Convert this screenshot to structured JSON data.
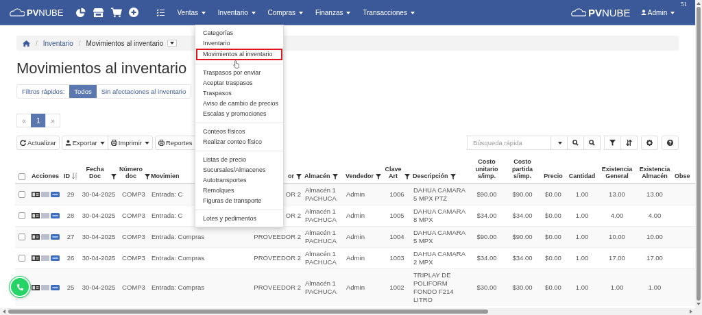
{
  "header": {
    "logo": "**PV**NUBE",
    "nav": [
      "Ventas",
      "Inventario",
      "Compras",
      "Finanzas",
      "Transacciones"
    ],
    "brand": "**PV**NUBE",
    "user": "Admin",
    "counter": "51"
  },
  "inventory_menu": {
    "groups": [
      [
        {
          "label": "Categorías",
          "selected": false
        },
        {
          "label": "Inventario",
          "selected": false
        },
        {
          "label": "Movimientos al inventario",
          "selected": true
        }
      ],
      [
        {
          "label": "Traspasos por enviar",
          "selected": false
        },
        {
          "label": "Aceptar traspasos",
          "selected": false
        },
        {
          "label": "Traspasos",
          "selected": false
        },
        {
          "label": "Aviso de cambio de precios",
          "selected": false
        },
        {
          "label": "Escalas y promociones",
          "selected": false
        }
      ],
      [
        {
          "label": "Conteos físicos",
          "selected": false
        },
        {
          "label": "Realizar conteo físico",
          "selected": false
        }
      ],
      [
        {
          "label": "Listas de precio",
          "selected": false
        },
        {
          "label": "Sucursales/Almacenes",
          "selected": false
        },
        {
          "label": "Autotransportes",
          "selected": false
        },
        {
          "label": "Remolques",
          "selected": false
        },
        {
          "label": "Figuras de transporte",
          "selected": false
        }
      ],
      [
        {
          "label": "Lotes y pedimentos",
          "selected": false
        }
      ]
    ]
  },
  "breadcrumb": {
    "separator": "/",
    "items": [
      "Inventario",
      "Movimientos al inventario"
    ]
  },
  "title": "Movimientos al inventario",
  "quick_filters": {
    "label": "Filtros rápidos:",
    "options": [
      {
        "label": "Todos",
        "selected": true
      },
      {
        "label": "Sin afectaciones al inventario",
        "selected": false
      }
    ]
  },
  "pagination": {
    "prev": "«",
    "pages": [
      {
        "label": "1",
        "selected": true
      }
    ],
    "next": "»"
  },
  "toolbar": {
    "buttons": [
      {
        "label": "Actualizar",
        "dropdown": false
      },
      {
        "label": "Exportar",
        "dropdown": true
      },
      {
        "label": "Imprimir",
        "dropdown": true
      },
      {
        "label": "Reportes",
        "dropdown": false
      }
    ]
  },
  "search": {
    "placeholder": "Búsqueda rápida"
  },
  "table": {
    "columns": [
      {
        "kind": "checkbox",
        "checked": false
      },
      {
        "kind": "label",
        "label": "Acciones",
        "filter": false,
        "sorted": false
      },
      {
        "kind": "label",
        "label": "ID",
        "filter": false,
        "sorted": true
      },
      {
        "kind": "label",
        "label": "Fecha Doc",
        "filter": true,
        "sorted": false
      },
      {
        "kind": "label",
        "label": "Número doc",
        "filter": true,
        "sorted": false
      },
      {
        "kind": "label",
        "label": "Movimien",
        "filter": false,
        "sorted": false
      },
      {
        "kind": "label",
        "label": "or",
        "filter": true,
        "sorted": false
      },
      {
        "kind": "label",
        "label": "Almacén",
        "filter": true,
        "sorted": false
      },
      {
        "kind": "label",
        "label": "Vendedor",
        "filter": true,
        "sorted": false
      },
      {
        "kind": "label",
        "label": "Clave Art",
        "filter": true,
        "sorted": false
      },
      {
        "kind": "label",
        "label": "Descripción",
        "filter": true,
        "sorted": false
      },
      {
        "kind": "label",
        "label": "Costo unitario s/imp.",
        "filter": false,
        "sorted": false
      },
      {
        "kind": "label",
        "label": "Costo partida s/imp.",
        "filter": false,
        "sorted": false
      },
      {
        "kind": "label",
        "label": "Precio",
        "filter": false,
        "sorted": false
      },
      {
        "kind": "label",
        "label": "Cantidad",
        "filter": false,
        "sorted": false
      },
      {
        "kind": "label",
        "label": "Existencia General",
        "filter": false,
        "sorted": false
      },
      {
        "kind": "label",
        "label": "Existencia Almacén",
        "filter": false,
        "sorted": false
      },
      {
        "kind": "label",
        "label": "Obse",
        "filter": false,
        "sorted": false
      }
    ],
    "rows": [
      {
        "checked": false,
        "cells": [
          "",
          "",
          "29",
          "30-04-2025",
          "COMP3",
          "Entrada: C",
          "OR 2",
          "Almacén 1 PACHUCA",
          "Admin",
          "1006",
          "DAHUA CAMARA 5 MPX PTZ",
          "$90.00",
          "$90.00",
          "$0.00",
          "1.00",
          "13.00",
          "13.00"
        ]
      },
      {
        "checked": false,
        "cells": [
          "",
          "",
          "28",
          "30-04-2025",
          "COMP3",
          "Entrada: C",
          "OR 2",
          "Almacén 1 PACHUCA",
          "Admin",
          "1005",
          "DAHUA CAMARA 8 MPX",
          "$34.00",
          "$34.00",
          "$0.00",
          "1.00",
          "4.00",
          "4.00"
        ]
      },
      {
        "checked": false,
        "cells": [
          "",
          "",
          "27",
          "30-04-2025",
          "COMP3",
          "Entrada: Compras",
          "PROVEEDOR 2",
          "Almacén 1 PACHUCA",
          "Admin",
          "1004",
          "DAHUA CAMARA 5 MPX",
          "$90.00",
          "$90.00",
          "$0.00",
          "1.00",
          "10.00",
          "10.00"
        ]
      },
      {
        "checked": false,
        "cells": [
          "",
          "",
          "26",
          "30-04-2025",
          "COMP3",
          "Entrada: Compras",
          "PROVEEDOR 2",
          "Almacén 1 PACHUCA",
          "Admin",
          "1003",
          "DAHUA CAMARA 2 MPX",
          "$34.00",
          "$34.00",
          "$0.00",
          "1.00",
          "17.00",
          "17.00"
        ]
      },
      {
        "cells": [
          "",
          "",
          "25",
          "30-04-2025",
          "COMP3",
          "Entrada: Compras",
          "PROVEEDOR 2",
          "Almacén 1 PACHUCA",
          "Admin",
          "1002",
          "TRIPLAY DE POLIFORM FONDO F214 LITRO",
          "$30.00",
          "$30.00",
          "$0.00",
          "1.00",
          "1.00",
          "1.00"
        ]
      }
    ]
  }
}
